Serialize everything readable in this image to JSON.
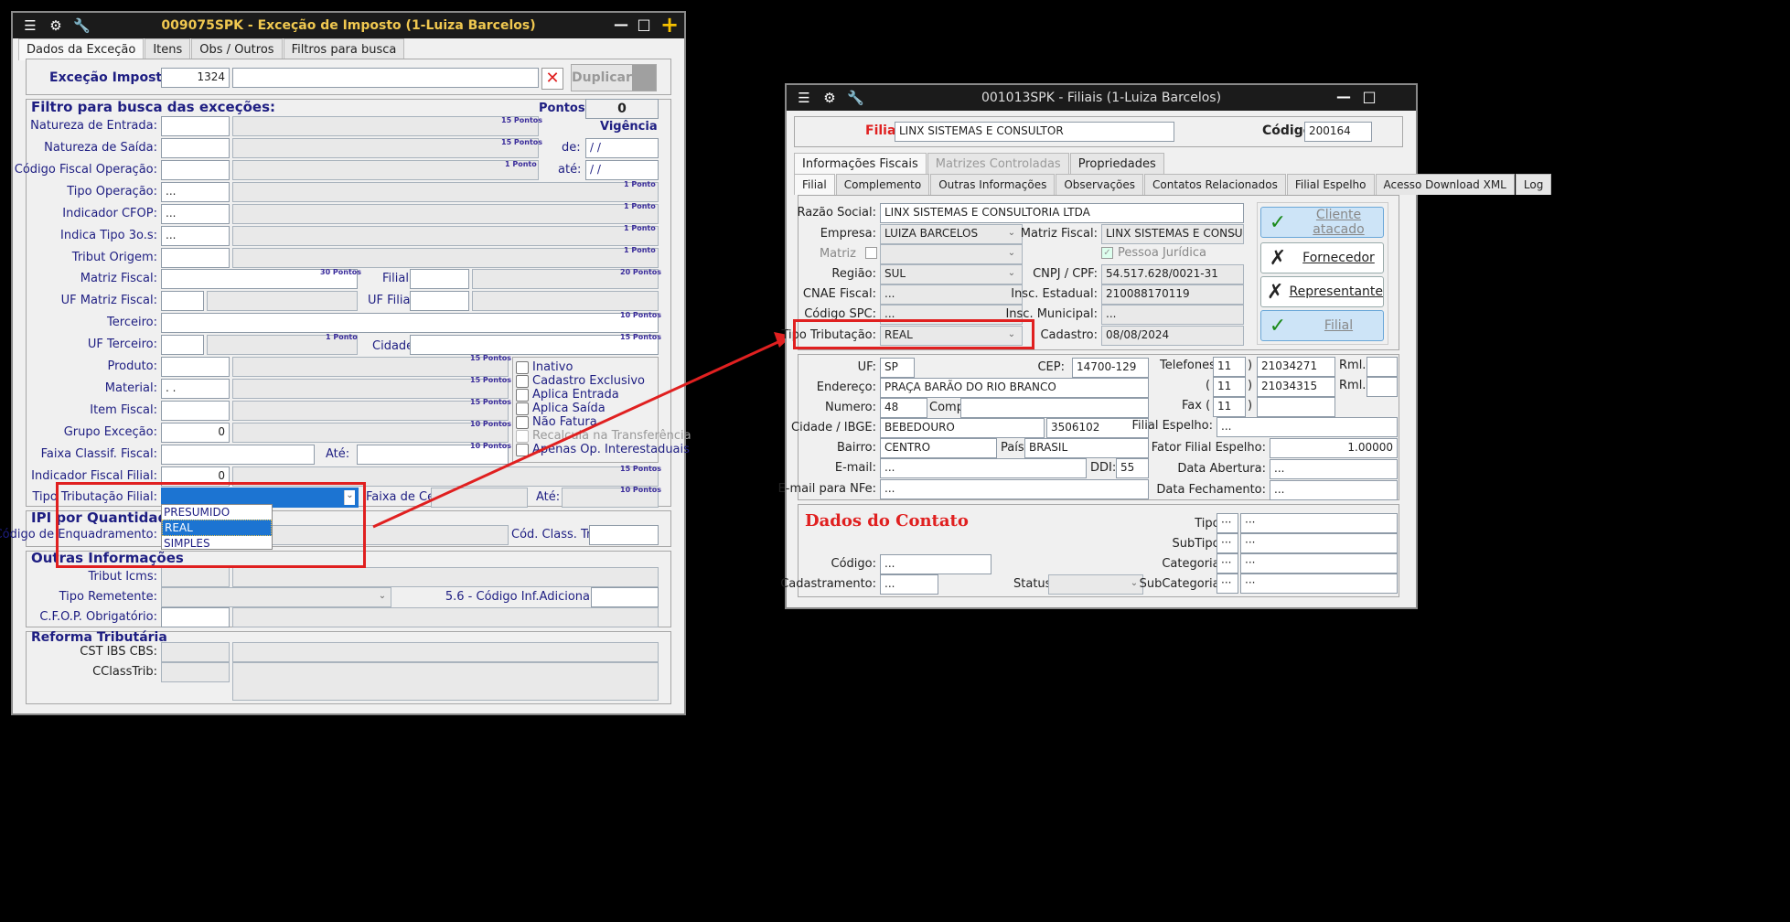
{
  "left": {
    "title": "009075SPK - Exceção de Imposto (1-Luiza Barcelos)",
    "tabs": [
      "Dados da Exceção",
      "Itens",
      "Obs / Outros",
      "Filtros para busca"
    ],
    "excecao_label": "Exceção Imposto",
    "excecao_value": "1324",
    "duplicar": "Duplicar",
    "filtro_title": "Filtro para busca das exceções:",
    "pontos_label": "Pontos:",
    "pontos_value": "0",
    "vigencia": "Vigência",
    "de_label": "de:",
    "ate_label": "até:",
    "date_placeholder": "/ /",
    "fields": {
      "natureza_entrada": "Natureza de Entrada:",
      "natureza_saida": "Natureza de Saída:",
      "cfo": "Código Fiscal Operação:",
      "tipo_operacao": "Tipo Operação:",
      "indicador_cfop": "Indicador CFOP:",
      "indica_tipo": "Indica Tipo 3o.s:",
      "tribut_origem": "Tribut Origem:",
      "matriz_fiscal": "Matriz Fiscal:",
      "filial": "Filial:",
      "uf_matriz": "UF Matriz Fiscal:",
      "uf_filial": "UF Filial:",
      "terceiro": "Terceiro:",
      "uf_terceiro": "UF Terceiro:",
      "cidade": "Cidade:",
      "produto": "Produto:",
      "material": "Material:",
      "item_fiscal": "Item Fiscal:",
      "grupo_excecao": "Grupo Exceção:",
      "faixa_classif": "Faixa Classif. Fiscal:",
      "ate": "Até:",
      "indicador_fiscal_filial": "Indicador Fiscal Filial:",
      "tipo_tributacao_filial": "Tipo Tributação Filial:",
      "faixa_cest": "Faixa de Cest:",
      "ate2": "Até:"
    },
    "values": {
      "tipo_operacao": "...",
      "indicador_cfop": "...",
      "indica_tipo": "...",
      "material": ". .",
      "grupo_excecao": "0",
      "indicador_fiscal_filial": "0"
    },
    "pontos_tags": {
      "p15": "15 Pontos",
      "p1": "1 Ponto",
      "p30": "30 Pontos",
      "p20": "20 Pontos",
      "p10": "10 Pontos"
    },
    "checks": [
      "Inativo",
      "Cadastro Exclusivo",
      "Aplica Entrada",
      "Aplica Saída",
      "Não Fatura",
      "Recalcula na Transferência",
      "Apenas Op. Interestaduais"
    ],
    "dropdown_options": [
      "PRESUMIDO",
      "REAL",
      "SIMPLES NACIONAL"
    ],
    "ipi_title": "IPI por Quantidade",
    "cod_enquadramento": "Código de Enquadramento:",
    "cod_class_trib": "Cód. Class. Trib.:",
    "outras_title": "Outras Informações",
    "tribut_icms": "Tribut Icms:",
    "tipo_remetente": "Tipo Remetente:",
    "cod_inf_adicional": "5.6 - Código Inf.Adicional:",
    "cfop_obrig": "C.F.O.P. Obrigatório:",
    "reforma_title": "Reforma Tributária",
    "cst_ibs": "CST IBS CBS:",
    "cclasstrib": "CClassTrib:"
  },
  "right": {
    "title": "001013SPK - Filiais (1-Luiza Barcelos)",
    "filial_label": "Filial",
    "filial_value": "LINX SISTEMAS E CONSULTOR",
    "codigo_label": "Código",
    "codigo_value": "200164",
    "tabs1": [
      "Informações Fiscais",
      "Matrizes Controladas",
      "Propriedades"
    ],
    "tabs2": [
      "Filial",
      "Complemento",
      "Outras Informações",
      "Observações",
      "Contatos Relacionados",
      "Filial Espelho",
      "Acesso Download XML",
      "Log"
    ],
    "razao_label": "Razão Social:",
    "razao_value": "LINX SISTEMAS E CONSULTORIA LTDA",
    "empresa_label": "Empresa:",
    "empresa_value": "LUIZA BARCELOS",
    "matriz_fiscal_label": "Matriz Fiscal:",
    "matriz_fiscal_value": "LINX SISTEMAS E CONSULT(",
    "matriz_label": "Matriz",
    "pessoa_juridica": "Pessoa Jurídica",
    "regiao_label": "Região:",
    "regiao_value": "SUL",
    "cnpj_label": "CNPJ / CPF:",
    "cnpj_value": "54.517.628/0021-31",
    "cnae_label": "CNAE Fiscal:",
    "cnae_value": "...",
    "insc_est_label": "Insc. Estadual:",
    "insc_est_value": "210088170119",
    "spc_label": "Código SPC:",
    "spc_value": "...",
    "insc_mun_label": "Insc. Municipal:",
    "insc_mun_value": "...",
    "tipo_trib_label": "Tipo Tributação:",
    "tipo_trib_value": "REAL",
    "cadastro_label": "Cadastro:",
    "cadastro_value": "08/08/2024",
    "btn_cliente": "Cliente atacado",
    "btn_fornecedor": "Fornecedor",
    "btn_representante": "Representante",
    "btn_filial": "Filial",
    "uf_label": "UF:",
    "uf_value": "SP",
    "cep_label": "CEP:",
    "cep_value": "14700-129",
    "tel_label": "Telefones (",
    "ddd": "11",
    "tel1": "21034271",
    "tel2": "21034315",
    "rml_label": "Rml.:",
    "end_label": "Endereço:",
    "end_value": "PRAÇA BARÃO DO RIO BRANCO",
    "num_label": "Numero:",
    "num_value": "48",
    "compl_label": "Compl.",
    "fax_label": "Fax (",
    "cidade_label": "Cidade / IBGE:",
    "cidade_value": "BEBEDOURO",
    "ibge_value": "3506102",
    "filial_espelho_label": "Filial Espelho:",
    "filial_espelho_value": "...",
    "bairro_label": "Bairro:",
    "bairro_value": "CENTRO",
    "pais_label": "País:",
    "pais_value": "BRASIL",
    "fator_label": "Fator Filial Espelho:",
    "fator_value": "1.00000",
    "email_label": "E-mail:",
    "email_value": "...",
    "ddi_label": "DDI:",
    "ddi_value": "55",
    "abertura_label": "Data Abertura:",
    "abertura_value": "...",
    "email_nfe_label": "E-mail para NFe:",
    "email_nfe_value": "...",
    "fechamento_label": "Data Fechamento:",
    "fechamento_value": "...",
    "contato_title": "Dados do Contato",
    "tipo_label": "Tipo:",
    "subtipo_label": "SubTipo:",
    "categoria_label": "Categoria:",
    "subcategoria_label": "SubCategoria:",
    "codigo2_label": "Código:",
    "codigo2_value": "...",
    "cadastramento_label": "Cadastramento:",
    "cadastramento_value": "...",
    "status_label": "Status:",
    "dots": "...",
    "ellipsis": "···"
  }
}
